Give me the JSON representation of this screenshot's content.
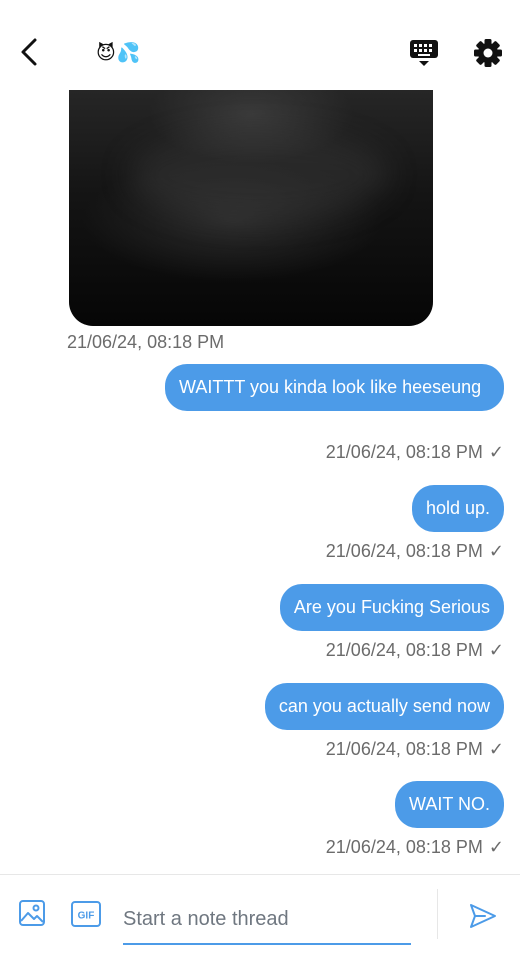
{
  "header": {
    "title_emojis": "😈💦",
    "icons": [
      "chevron-left-icon",
      "keyboard-icon",
      "gear-icon"
    ]
  },
  "photo_message": {
    "timestamp": "21/06/24, 08:18 PM"
  },
  "messages": [
    {
      "text": "WAITTT you kinda look like heeseung",
      "timestamp": "21/06/24, 08:18 PM",
      "status": "✓"
    },
    {
      "text": "hold up.",
      "timestamp": "21/06/24, 08:18 PM",
      "status": "✓"
    },
    {
      "text": "Are you Fucking Serious",
      "timestamp": "21/06/24, 08:18 PM",
      "status": "✓"
    },
    {
      "text": "can you actually send now",
      "timestamp": "21/06/24, 08:18 PM",
      "status": "✓"
    },
    {
      "text": "WAIT NO.",
      "timestamp": "21/06/24, 08:18 PM",
      "status": "✓"
    }
  ],
  "composer": {
    "placeholder": "Start a note thread",
    "value": "",
    "gif_label": "GIF",
    "icons": [
      "image-icon",
      "gif-icon",
      "send-icon"
    ]
  },
  "colors": {
    "accent": "#4c9be8",
    "bubble_text": "#ffffff",
    "timestamp_text": "#6b6b6b",
    "background": "#ffffff"
  }
}
